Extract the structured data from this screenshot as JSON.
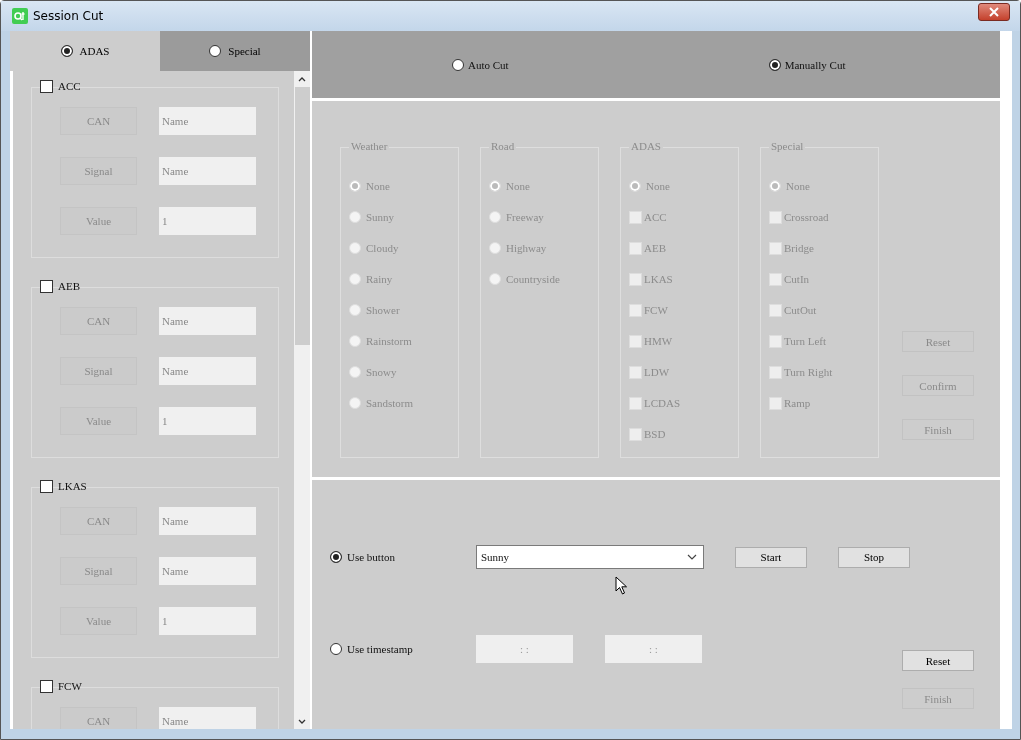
{
  "window": {
    "title": "Session Cut"
  },
  "left_tabs": [
    {
      "label": "ADAS",
      "selected": true
    },
    {
      "label": "Special",
      "selected": false
    }
  ],
  "signal_groups": [
    {
      "label": "ACC",
      "checked": false,
      "disabled": true,
      "rows": [
        {
          "label": "CAN",
          "value": "Name"
        },
        {
          "label": "Signal",
          "value": "Name"
        },
        {
          "label": "Value",
          "value": "1"
        }
      ]
    },
    {
      "label": "AEB",
      "checked": false,
      "disabled": true,
      "rows": [
        {
          "label": "CAN",
          "value": "Name"
        },
        {
          "label": "Signal",
          "value": "Name"
        },
        {
          "label": "Value",
          "value": "1"
        }
      ]
    },
    {
      "label": "LKAS",
      "checked": false,
      "disabled": true,
      "rows": [
        {
          "label": "CAN",
          "value": "Name"
        },
        {
          "label": "Signal",
          "value": "Name"
        },
        {
          "label": "Value",
          "value": "1"
        }
      ]
    },
    {
      "label": "FCW",
      "checked": false,
      "disabled": true,
      "rows": [
        {
          "label": "CAN",
          "value": "Name"
        }
      ]
    }
  ],
  "cut_mode": [
    {
      "label": "Auto Cut",
      "selected": false
    },
    {
      "label": "Manually Cut",
      "selected": true
    }
  ],
  "filters": {
    "disabled": true,
    "groups": [
      {
        "title": "Weather",
        "options": [
          {
            "kind": "radio",
            "label": "None",
            "selected": true
          },
          {
            "kind": "radio",
            "label": "Sunny",
            "selected": false
          },
          {
            "kind": "radio",
            "label": "Cloudy",
            "selected": false
          },
          {
            "kind": "radio",
            "label": "Rainy",
            "selected": false
          },
          {
            "kind": "radio",
            "label": "Shower",
            "selected": false
          },
          {
            "kind": "radio",
            "label": "Rainstorm",
            "selected": false
          },
          {
            "kind": "radio",
            "label": "Snowy",
            "selected": false
          },
          {
            "kind": "radio",
            "label": "Sandstorm",
            "selected": false
          }
        ]
      },
      {
        "title": "Road",
        "options": [
          {
            "kind": "radio",
            "label": "None",
            "selected": true
          },
          {
            "kind": "radio",
            "label": "Freeway",
            "selected": false
          },
          {
            "kind": "radio",
            "label": "Highway",
            "selected": false
          },
          {
            "kind": "radio",
            "label": "Countryside",
            "selected": false
          }
        ]
      },
      {
        "title": "ADAS",
        "options": [
          {
            "kind": "radio",
            "label": "None",
            "selected": true
          },
          {
            "kind": "checkbox",
            "label": "ACC",
            "checked": false
          },
          {
            "kind": "checkbox",
            "label": "AEB",
            "checked": false
          },
          {
            "kind": "checkbox",
            "label": "LKAS",
            "checked": false
          },
          {
            "kind": "checkbox",
            "label": "FCW",
            "checked": false
          },
          {
            "kind": "checkbox",
            "label": "HMW",
            "checked": false
          },
          {
            "kind": "checkbox",
            "label": "LDW",
            "checked": false
          },
          {
            "kind": "checkbox",
            "label": "LCDAS",
            "checked": false
          },
          {
            "kind": "checkbox",
            "label": "BSD",
            "checked": false
          }
        ]
      },
      {
        "title": "Special",
        "options": [
          {
            "kind": "radio",
            "label": "None",
            "selected": true
          },
          {
            "kind": "checkbox",
            "label": "Crossroad",
            "checked": false
          },
          {
            "kind": "checkbox",
            "label": "Bridge",
            "checked": false
          },
          {
            "kind": "checkbox",
            "label": "CutIn",
            "checked": false
          },
          {
            "kind": "checkbox",
            "label": "CutOut",
            "checked": false
          },
          {
            "kind": "checkbox",
            "label": "Turn Left",
            "checked": false
          },
          {
            "kind": "checkbox",
            "label": "Turn Right",
            "checked": false
          },
          {
            "kind": "checkbox",
            "label": "Ramp",
            "checked": false
          }
        ]
      }
    ],
    "buttons": [
      {
        "label": "Reset",
        "disabled": true
      },
      {
        "label": "Confirm",
        "disabled": true
      },
      {
        "label": "Finish",
        "disabled": true
      }
    ]
  },
  "trigger": {
    "use_button": {
      "label": "Use button",
      "selected": true
    },
    "dropdown": {
      "value": "Sunny"
    },
    "buttons": [
      {
        "label": "Start",
        "disabled": false
      },
      {
        "label": "Stop",
        "disabled": false
      }
    ],
    "use_timestamp": {
      "label": "Use timestamp",
      "selected": false
    },
    "timestamps": [
      {
        "value": ":  :",
        "disabled": true
      },
      {
        "value": ":  :",
        "disabled": true
      }
    ],
    "side_buttons": [
      {
        "label": "Reset",
        "disabled": false
      },
      {
        "label": "Finish",
        "disabled": true
      }
    ]
  }
}
